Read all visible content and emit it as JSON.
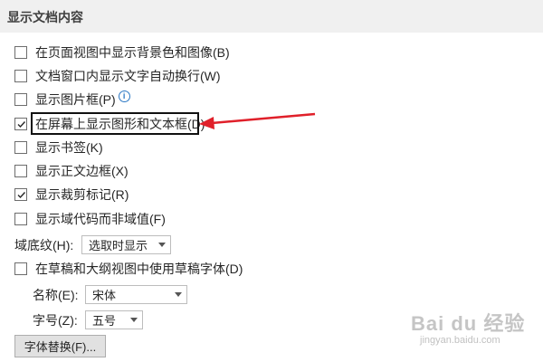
{
  "section": {
    "title": "显示文档内容"
  },
  "options": [
    {
      "label": "在页面视图中显示背景色和图像(B)",
      "checked": false
    },
    {
      "label": "文档窗口内显示文字自动换行(W)",
      "checked": false
    },
    {
      "label": "显示图片框(P)",
      "checked": false,
      "info_icon": "i"
    },
    {
      "label": "在屏幕上显示图形和文本框(D)",
      "checked": true
    },
    {
      "label": "显示书签(K)",
      "checked": false
    },
    {
      "label": "显示正文边框(X)",
      "checked": false
    },
    {
      "label": "显示裁剪标记(R)",
      "checked": true
    },
    {
      "label": "显示域代码而非域值(F)",
      "checked": false
    }
  ],
  "field_shading": {
    "label": "域底纹(H):",
    "value": "选取时显示"
  },
  "draft_font": {
    "label": "在草稿和大纲视图中使用草稿字体(D)",
    "checked": false
  },
  "font_name": {
    "label": "名称(E):",
    "value": "宋体"
  },
  "font_size": {
    "label": "字号(Z):",
    "value": "五号"
  },
  "font_substitution_button": "字体替换(F)...",
  "annotation": {
    "arrow_color": "#e0202a",
    "box_color": "#111111"
  },
  "watermark": {
    "logo": "Bai du 经验",
    "url": "jingyan.baidu.com"
  }
}
